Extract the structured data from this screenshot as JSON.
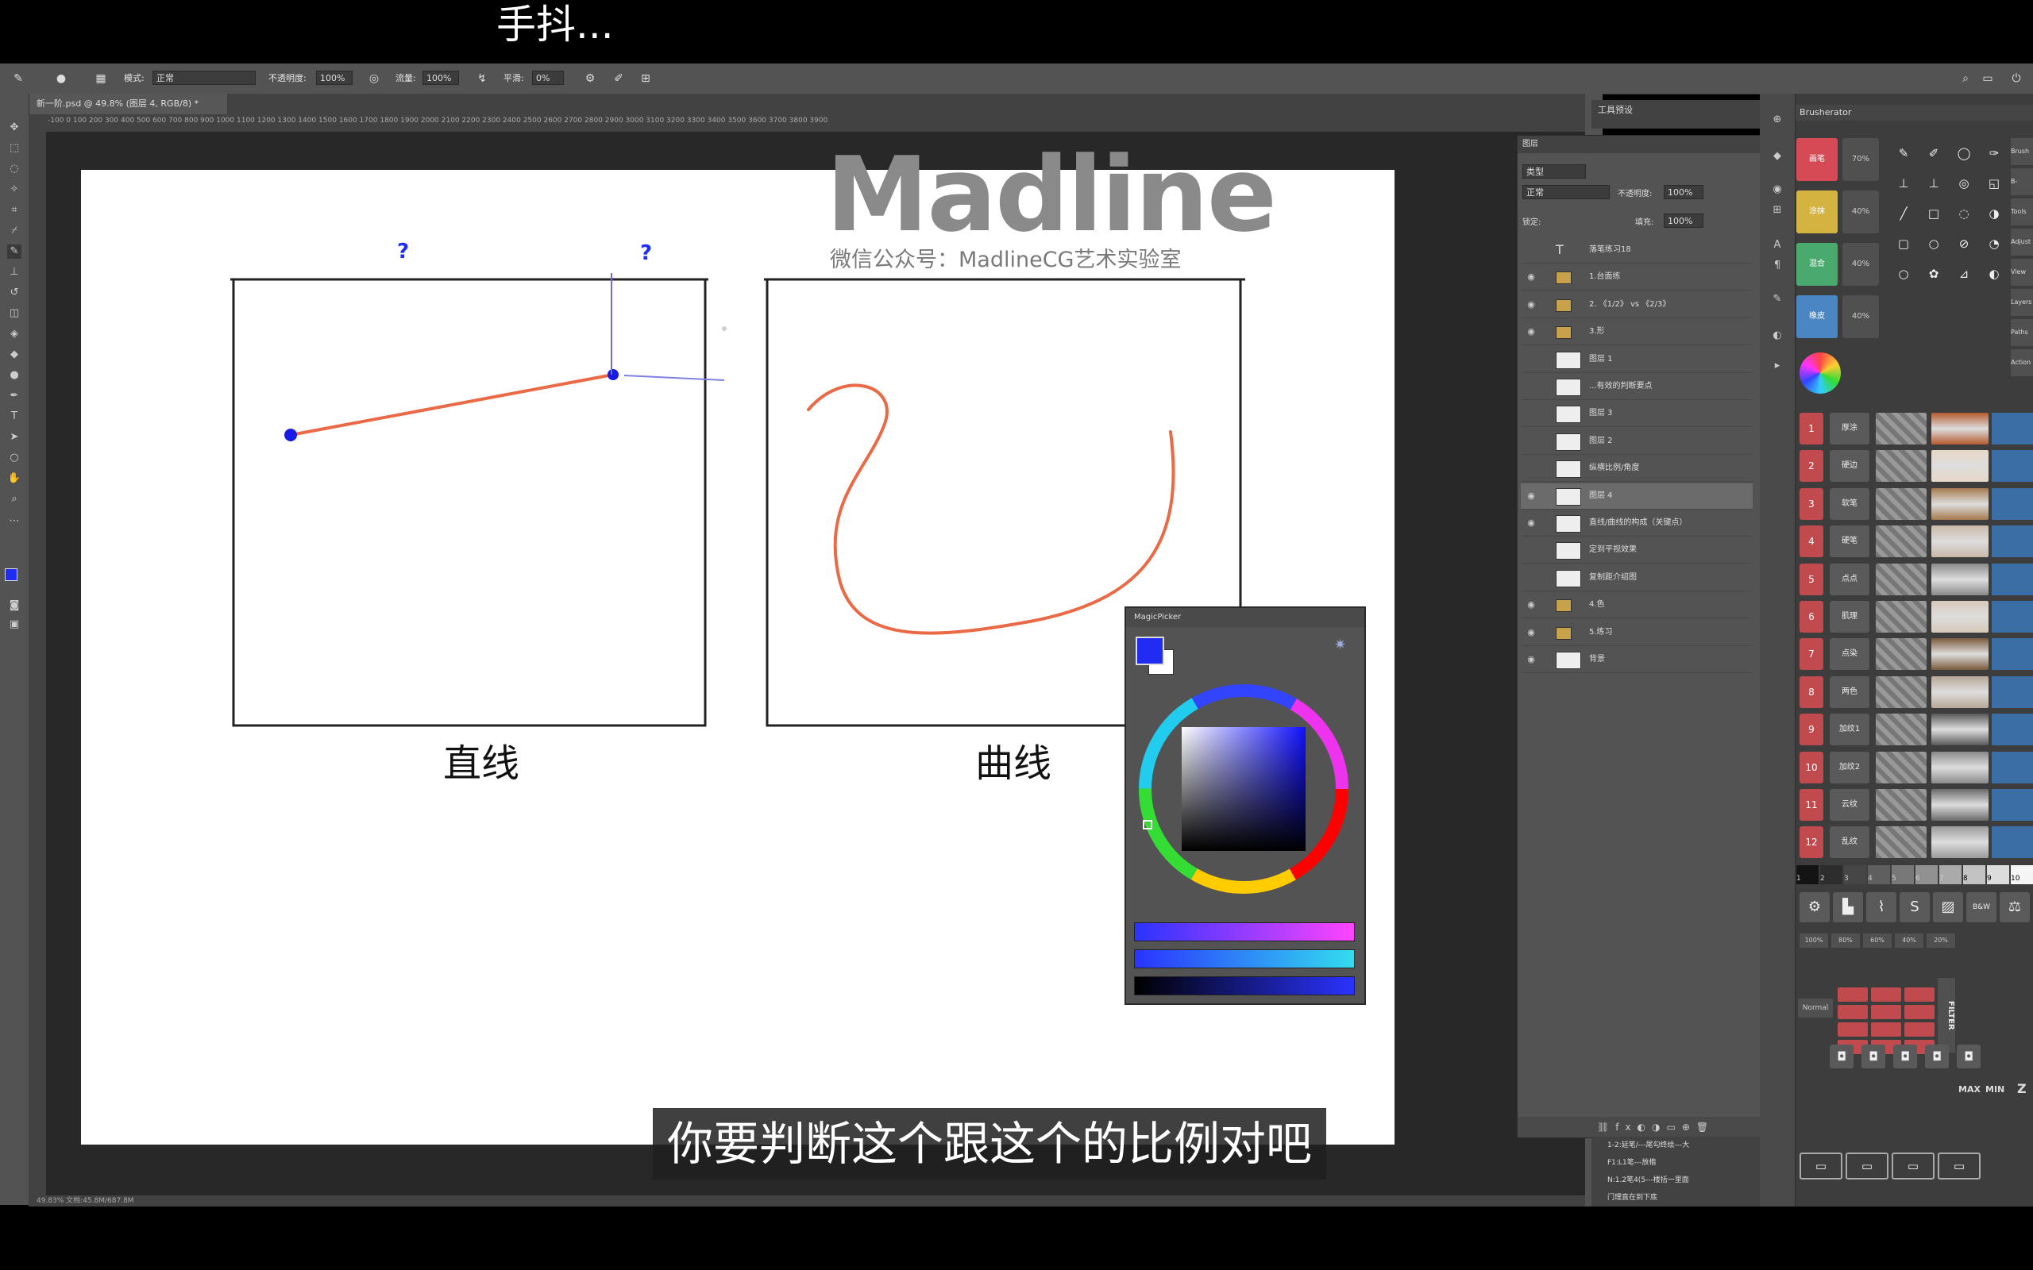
{
  "video": {
    "top_caption": "手抖...",
    "subtitle": "你要判断这个跟这个的比例对吧"
  },
  "options_bar": {
    "mode_label": "模式:",
    "mode_value": "正常",
    "opacity_label": "不透明度:",
    "opacity_value": "100%",
    "flow_label": "流量:",
    "flow_value": "100%",
    "smooth_label": "平滑:",
    "smooth_value": "0%"
  },
  "document": {
    "tab_title": "新一阶.psd @ 49.8% (图层 4, RGB/8) *",
    "status": "49.83%     文档:45.8M/687.8M"
  },
  "ruler_numbers": "-100  0   100  200  300  400  500  600  700  800  900  1000 1100 1200 1300 1400 1500 1600 1700 1800 1900 2000 2100 2200 2300 2400 2500 2600 2700 2800 2900 3000 3100 3200 3300 3400 3500 3600 3700 3800 3900",
  "canvas": {
    "brand_name": "Madline",
    "brand_subtitle": "微信公众号：MadlineCG艺术实验室",
    "left_label": "直线",
    "right_label": "曲线",
    "question_mark_1": "?",
    "question_mark_2": "?",
    "accent_color": "#ea6a47",
    "marker_color": "#1a1ae6"
  },
  "layers_panel": {
    "tab_label": "图层",
    "search_kind": "类型",
    "blend_mode": "正常",
    "opacity_label": "不透明度:",
    "opacity_value": "100%",
    "lock_label": "锁定:",
    "fill_label": "填充:",
    "fill_value": "100%",
    "layers": [
      {
        "name": "落笔练习18",
        "visible": false,
        "type": "text"
      },
      {
        "name": "1.台面练",
        "visible": true,
        "type": "group"
      },
      {
        "name": "2. 《1/2》 vs 《2/3》",
        "visible": true,
        "type": "group"
      },
      {
        "name": "3.形",
        "visible": true,
        "type": "group"
      },
      {
        "name": "图层 1",
        "visible": false,
        "type": "layer"
      },
      {
        "name": "...有效的判断要点",
        "visible": false,
        "type": "layer"
      },
      {
        "name": "图层 3",
        "visible": false,
        "type": "layer"
      },
      {
        "name": "图层 2",
        "visible": false,
        "type": "layer"
      },
      {
        "name": "纵横比例/角度",
        "visible": false,
        "type": "layer"
      },
      {
        "name": "图层 4",
        "visible": true,
        "type": "layer",
        "selected": true
      },
      {
        "name": "直线/曲线的构成（关键点）",
        "visible": true,
        "type": "layer"
      },
      {
        "name": "定到平视效果",
        "visible": false,
        "type": "layer"
      },
      {
        "name": "复制距介绍图",
        "visible": false,
        "type": "layer"
      },
      {
        "name": "4.色",
        "visible": true,
        "type": "group"
      },
      {
        "name": "5.练习",
        "visible": true,
        "type": "group"
      },
      {
        "name": "背景",
        "visible": true,
        "type": "background"
      }
    ]
  },
  "tool_presets": {
    "label": "工具预设",
    "items": [
      "1-2:延笔/---尾勾终绘---大",
      "F1:L1笔---放楷",
      "N:1.2笔4(5---楼括一里面",
      "门理直在到下底"
    ]
  },
  "magicpicker": {
    "title": "MagicPicker",
    "foreground": "#1f2cf2",
    "background": "#ffffff"
  },
  "brushes_panel": {
    "title": "Brusherator",
    "color_buttons": [
      {
        "label": "画笔",
        "color": "#d64a55",
        "pct": "70%"
      },
      {
        "label": "涂抹",
        "color": "#d4b340",
        "pct": "40%"
      },
      {
        "label": "混合",
        "color": "#4aa96c",
        "pct": "40%"
      },
      {
        "label": "橡皮",
        "color": "#4a86c4",
        "pct": "40%"
      }
    ],
    "numbered_brushes": [
      {
        "num": "1",
        "name": "厚涂"
      },
      {
        "num": "2",
        "name": "硬边"
      },
      {
        "num": "3",
        "name": "软笔"
      },
      {
        "num": "4",
        "name": "硬笔"
      },
      {
        "num": "5",
        "name": "点点"
      },
      {
        "num": "6",
        "name": "肌理"
      },
      {
        "num": "7",
        "name": "点染"
      },
      {
        "num": "8",
        "name": "两色"
      },
      {
        "num": "9",
        "name": "加纹1"
      },
      {
        "num": "10",
        "name": "加纹2"
      },
      {
        "num": "11",
        "name": "云纹"
      },
      {
        "num": "12",
        "name": "乱纹"
      }
    ],
    "side_labels": [
      "Brush",
      "B-spline",
      "Tools",
      "Adjust",
      "View",
      "Layers",
      "Paths",
      "Action"
    ],
    "percent_row": [
      "100%",
      "80%",
      "60%",
      "40%",
      "20%"
    ],
    "normal_label": "Normal",
    "filter_label": "FILTER",
    "max_label": "MAX",
    "min_label": "MIN",
    "bw_label": "B&W",
    "s_label": "S",
    "z_label": "Z",
    "num_row": [
      "1",
      "2",
      "3",
      "4",
      "5",
      "6",
      "7",
      "8",
      "9",
      "10"
    ]
  }
}
